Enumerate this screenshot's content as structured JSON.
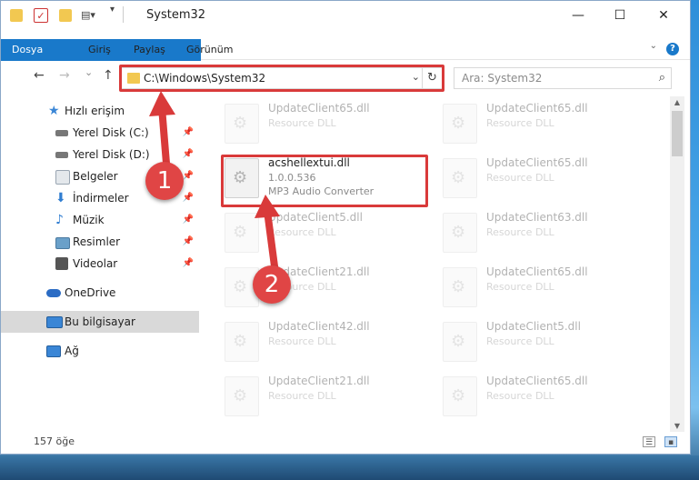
{
  "window": {
    "title": "System32",
    "controls": {
      "minimize": "—",
      "maximize": "☐",
      "close": "✕"
    }
  },
  "ribbon": {
    "tabs": [
      "Dosya",
      "Giriş",
      "Paylaş",
      "Görünüm"
    ],
    "help": "?"
  },
  "navigation": {
    "back": "←",
    "forward": "→",
    "recent": "⌄",
    "up": "↑",
    "address": "C:\\Windows\\System32",
    "search_placeholder": "Ara: System32"
  },
  "sidebar": {
    "items": [
      {
        "label": "Hızlı erişim",
        "icon": "star-icon",
        "color": "#3a86d6"
      },
      {
        "label": "Yerel Disk (C:)",
        "icon": "drive-icon",
        "color": "#777777",
        "pinned": "📌"
      },
      {
        "label": "Yerel Disk (D:)",
        "icon": "drive-icon",
        "color": "#777777",
        "pinned": "📌"
      },
      {
        "label": "Belgeler",
        "icon": "documents-icon",
        "color": "#9aa6b2",
        "pinned": "📌"
      },
      {
        "label": "İndirmeler",
        "icon": "download-icon",
        "color": "#2f7dd1",
        "pinned": "📌"
      },
      {
        "label": "Müzik",
        "icon": "music-icon",
        "color": "#2f7dd1",
        "pinned": "📌"
      },
      {
        "label": "Resimler",
        "icon": "pictures-icon",
        "color": "#6aa0c9",
        "pinned": "📌"
      },
      {
        "label": "Videolar",
        "icon": "videos-icon",
        "color": "#555555",
        "pinned": "📌"
      },
      {
        "label": "OneDrive",
        "icon": "cloud-icon",
        "color": "#2b6cc4"
      },
      {
        "label": "Bu bilgisayar",
        "icon": "computer-icon",
        "color": "#3a86d6"
      },
      {
        "label": "Ağ",
        "icon": "network-icon",
        "color": "#3a86d6"
      }
    ]
  },
  "files": {
    "highlighted": {
      "name": "acshellextui.dll",
      "version": "1.0.0.536",
      "description": "MP3 Audio Converter"
    },
    "left": [
      {
        "name": "UpdateClient65.dll",
        "type": "Resource DLL"
      },
      {
        "name": "UpdateClient5.dll",
        "type": "Resource DLL"
      },
      {
        "name": "UpdateClient21.dll",
        "type": "Resource DLL"
      },
      {
        "name": "UpdateClient42.dll",
        "type": "Resource DLL"
      },
      {
        "name": "UpdateClient21.dll",
        "type": "Resource DLL"
      }
    ],
    "right": [
      {
        "name": "UpdateClient65.dll",
        "type": "Resource DLL"
      },
      {
        "name": "UpdateClient65.dll",
        "type": "Resource DLL"
      },
      {
        "name": "UpdateClient63.dll",
        "type": "Resource DLL"
      },
      {
        "name": "UpdateClient65.dll",
        "type": "Resource DLL"
      },
      {
        "name": "UpdateClient5.dll",
        "type": "Resource DLL"
      },
      {
        "name": "UpdateClient65.dll",
        "type": "Resource DLL"
      }
    ]
  },
  "status": {
    "count": "157 öğe"
  },
  "annotations": {
    "step1": "1",
    "step2": "2",
    "highlight_color": "#d93a3a"
  }
}
